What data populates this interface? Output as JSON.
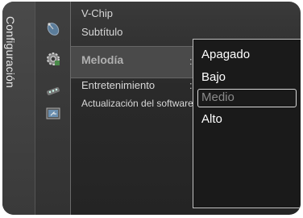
{
  "sidebar": {
    "tab_label": "Configuración",
    "icons": [
      "satellite-dish-icon",
      "gear-icon",
      "remote-control-icon",
      "software-update-icon"
    ]
  },
  "menu": {
    "items": [
      {
        "label": "V-Chip"
      },
      {
        "label": "Subtítulo"
      },
      {
        "label": "Melodía",
        "selected": true,
        "value_separator": ":"
      },
      {
        "label": "Entretenimiento",
        "value_separator": ":"
      },
      {
        "label": "Actualización del software"
      }
    ]
  },
  "dropdown": {
    "options": [
      "Apagado",
      "Bajo",
      "Medio",
      "Alto"
    ],
    "selected_option": "Medio"
  },
  "colors": {
    "panel_background": "#2a2a2a",
    "text": "#d8d8d8",
    "option_text": "#ffffff",
    "selected_option_text": "#8a8a8a"
  }
}
